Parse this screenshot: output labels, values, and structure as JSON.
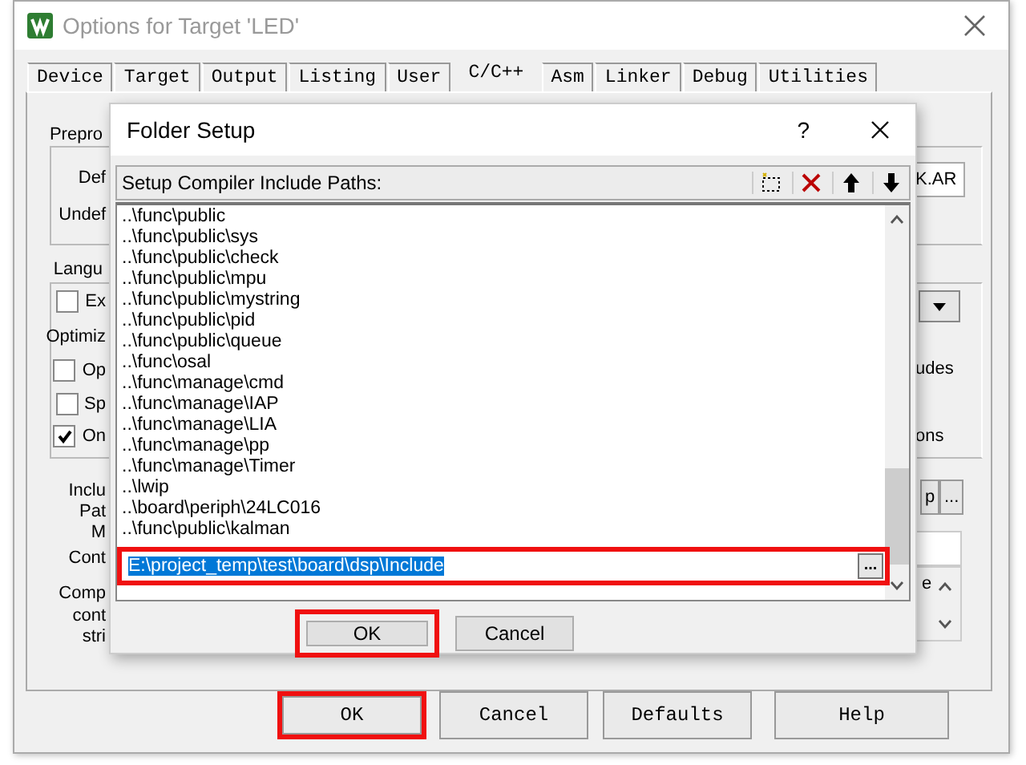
{
  "window": {
    "title": "Options for Target 'LED'"
  },
  "tabs": [
    {
      "label": "Device",
      "selected": false
    },
    {
      "label": "Target",
      "selected": false
    },
    {
      "label": "Output",
      "selected": false
    },
    {
      "label": "Listing",
      "selected": false
    },
    {
      "label": "User",
      "selected": false
    },
    {
      "label": "C/C++",
      "selected": true
    },
    {
      "label": "Asm",
      "selected": false
    },
    {
      "label": "Linker",
      "selected": false
    },
    {
      "label": "Debug",
      "selected": false
    },
    {
      "label": "Utilities",
      "selected": false
    }
  ],
  "options_panel": {
    "fragments": [
      {
        "kind": "group",
        "text": "Prepro"
      },
      {
        "kind": "label",
        "text": "Def"
      },
      {
        "kind": "label",
        "text": "Undef"
      },
      {
        "kind": "group",
        "text": "Langu"
      },
      {
        "kind": "checkbox",
        "text": "Ex",
        "checked": false
      },
      {
        "kind": "label",
        "text": "Optimiz"
      },
      {
        "kind": "checkbox",
        "text": "Op",
        "checked": false
      },
      {
        "kind": "checkbox",
        "text": "Sp",
        "checked": false
      },
      {
        "kind": "checkbox",
        "text": "On",
        "checked": true
      },
      {
        "kind": "label",
        "text": "Inclu"
      },
      {
        "kind": "label",
        "text": "Pat"
      },
      {
        "kind": "label",
        "text": "M"
      },
      {
        "kind": "label",
        "text": "Cont"
      },
      {
        "kind": "label",
        "text": "Comp"
      },
      {
        "kind": "label",
        "text": "cont"
      },
      {
        "kind": "label",
        "text": "stri"
      },
      {
        "kind": "field",
        "text": "K.AR"
      },
      {
        "kind": "label",
        "text": "udes"
      },
      {
        "kind": "label",
        "text": "ons"
      },
      {
        "kind": "button",
        "text": "p"
      },
      {
        "kind": "button",
        "text": "..."
      },
      {
        "kind": "label",
        "text": "e"
      }
    ]
  },
  "buttons": [
    {
      "label": "OK",
      "highlighted": true
    },
    {
      "label": "Cancel",
      "highlighted": false
    },
    {
      "label": "Defaults",
      "highlighted": false
    },
    {
      "label": "Help",
      "highlighted": false
    }
  ],
  "folder_setup": {
    "title": "Folder Setup",
    "help": "?",
    "list_label": "Setup Compiler Include Paths:",
    "paths": [
      "..\\func\\public",
      "..\\func\\public\\sys",
      "..\\func\\public\\check",
      "..\\func\\public\\mpu",
      "..\\func\\public\\mystring",
      "..\\func\\public\\pid",
      "..\\func\\public\\queue",
      "..\\func\\osal",
      "..\\func\\manage\\cmd",
      "..\\func\\manage\\IAP",
      "..\\func\\manage\\LIA",
      "..\\func\\manage\\pp",
      "..\\func\\manage\\Timer",
      "..\\lwip",
      "..\\board\\periph\\24LC016",
      "..\\func\\public\\kalman"
    ],
    "edit": {
      "value": "E:\\project_temp\\test\\board\\dsp\\Include",
      "highlighted": true
    },
    "browse": "...",
    "buttons": [
      {
        "label": "OK",
        "highlighted": true
      },
      {
        "label": "Cancel",
        "highlighted": false
      }
    ]
  }
}
